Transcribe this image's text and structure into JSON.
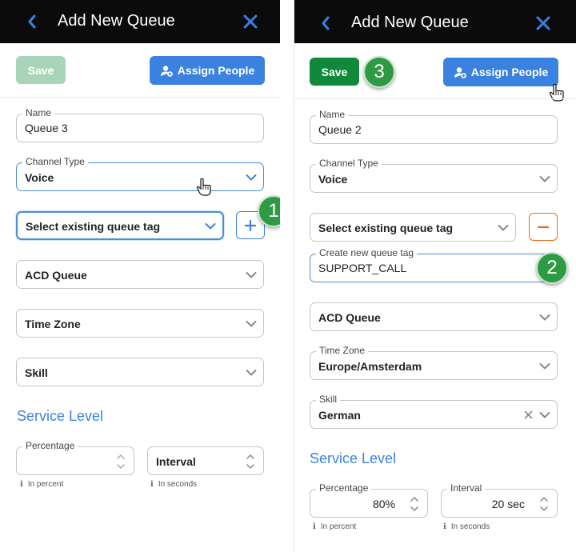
{
  "left": {
    "header_title": "Add New Queue",
    "save_label": "Save",
    "assign_label": "Assign People",
    "name": {
      "label": "Name",
      "value": "Queue 3"
    },
    "channel_type": {
      "label": "Channel Type",
      "value": "Voice"
    },
    "queue_tag_select": {
      "placeholder": "Select existing queue tag"
    },
    "acd_queue": {
      "placeholder": "ACD Queue"
    },
    "time_zone": {
      "placeholder": "Time Zone"
    },
    "skill": {
      "placeholder": "Skill"
    },
    "service_level_title": "Service Level",
    "percentage": {
      "label": "Percentage",
      "value": "",
      "hint": "In percent"
    },
    "interval": {
      "placeholder": "Interval",
      "hint": "In seconds"
    },
    "step_badge": "1"
  },
  "right": {
    "header_title": "Add New Queue",
    "save_label": "Save",
    "assign_label": "Assign People",
    "name": {
      "label": "Name",
      "value": "Queue 2"
    },
    "channel_type": {
      "label": "Channel Type",
      "value": "Voice"
    },
    "queue_tag_select": {
      "placeholder": "Select existing queue tag"
    },
    "new_queue_tag": {
      "label": "Create new queue tag",
      "value": "SUPPORT_CALL"
    },
    "acd_queue": {
      "placeholder": "ACD Queue"
    },
    "time_zone": {
      "label": "Time Zone",
      "value": "Europe/Amsterdam"
    },
    "skill": {
      "label": "Skill",
      "value": "German"
    },
    "service_level_title": "Service Level",
    "percentage": {
      "label": "Percentage",
      "value": "80%",
      "hint": "In percent"
    },
    "interval": {
      "label": "Interval",
      "value": "20 sec",
      "hint": "In seconds"
    },
    "step_badge_tag": "2",
    "step_badge_save": "3"
  },
  "colors": {
    "header_bg": "#0b0b0b",
    "accent_blue": "#3b82e0",
    "save_green": "#0e8a3a",
    "save_green_disabled": "#a8d5b9",
    "badge_green": "#2e9a44",
    "remove_orange": "#e46a1c"
  },
  "icons": {
    "back": "chevron-left-icon",
    "close": "close-icon",
    "assign": "person-add-icon",
    "add": "plus-icon",
    "remove": "minus-icon",
    "dropdown": "chevron-down-icon",
    "clear": "clear-x-icon",
    "spinner": "up-down-icon",
    "info": "info-icon",
    "pointer": "hand-cursor-icon"
  }
}
